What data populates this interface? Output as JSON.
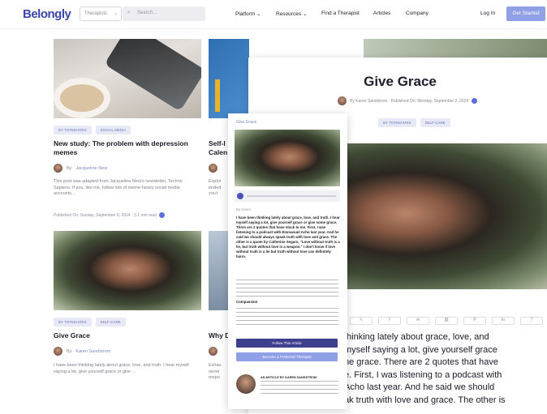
{
  "nav": {
    "logo": "Belongly",
    "select_value": "Therapists",
    "search_placeholder": "Search...",
    "menu": [
      {
        "label": "Platform",
        "has_dropdown": true
      },
      {
        "label": "Resources",
        "has_dropdown": true
      },
      {
        "label": "Find a Therapist",
        "has_dropdown": false
      },
      {
        "label": "Articles",
        "has_dropdown": false
      },
      {
        "label": "Company",
        "has_dropdown": false
      }
    ],
    "login": "Log In",
    "cta": "Get Started"
  },
  "cards": [
    {
      "tags": [
        "BY TOTEM KRIS",
        "SOCIAL MEDIA"
      ],
      "title": "New study: The problem with depression memes",
      "author_prefix": "By",
      "author": "Jacqueline Nesi",
      "excerpt": "This post was adapted from Jacqueline Nesi's newsletter, Techno Sapiens. If you, like me, follow lots of meme-heavy social media accounts...",
      "published": "Published On: Sunday, September 8, 2024 · 5.1 min read"
    },
    {
      "tags": [
        "BY TOTEM KRIS",
        "SELF-CARE"
      ],
      "title": "Give Grace",
      "author_prefix": "By",
      "author": "Karen Sandstrom",
      "excerpt": "I have been thinking lately about grace, love, and truth. I hear myself saying a lot, give yourself grace or give ..."
    },
    {
      "title_partial": "Self-l",
      "title_partial2": "Calen",
      "excerpt_partial": [
        "Explor",
        "ended",
        "you'r"
      ],
      "title_partial3": "Why D",
      "excerpt_partial3": [
        "Exhau",
        "never",
        "respo"
      ]
    }
  ],
  "article": {
    "title": "Give Grace",
    "byline": "By Karen Sandstrom · Published On: Monday, September 2, 2024",
    "tags": [
      "BY TOTEM KRIS",
      "SELF-CARE"
    ],
    "share_count": 7,
    "body_lines": [
      "thinking lately about grace, love, and",
      "myself saying a lot, give yourself grace",
      "ne grace. There are 2 quotes that have",
      "e. First, I was listening to a podcast with",
      "Acho last year. And he said we should",
      "ak truth with love and grace. The other is"
    ]
  },
  "mobile": {
    "breadcrumb": "Give Grace",
    "author_line": "By Karen",
    "quote_lines": [
      "I have been thinking lately about grace, love, and truth. I",
      "hear myself saying a lot, give yourself grace or give",
      "some grace. There are 2 quotes that have stuck to me.",
      "First, I was listening to a podcast with Emmanuel Acho",
      "last year. And he said we should always speak truth with",
      "love and grace. The other is a quote by Catherine Segars,",
      "\"Love without truth is a lie, but truth without love is a",
      "weapon.\" I don't know if love without truth is a lie but",
      "truth without love can definitely harm."
    ],
    "section_heading": "Compassion",
    "button_primary": "Follow This Article",
    "button_secondary": "Become a Preferred Therapist",
    "author_card_label": "AN ARTICLE BY KAREN SANDSTROM"
  },
  "colors": {
    "brand": "#3b46a8",
    "cta": "#8fa0e6",
    "tag_bg": "#e7e9f7",
    "accent": "#5c6fd6"
  }
}
